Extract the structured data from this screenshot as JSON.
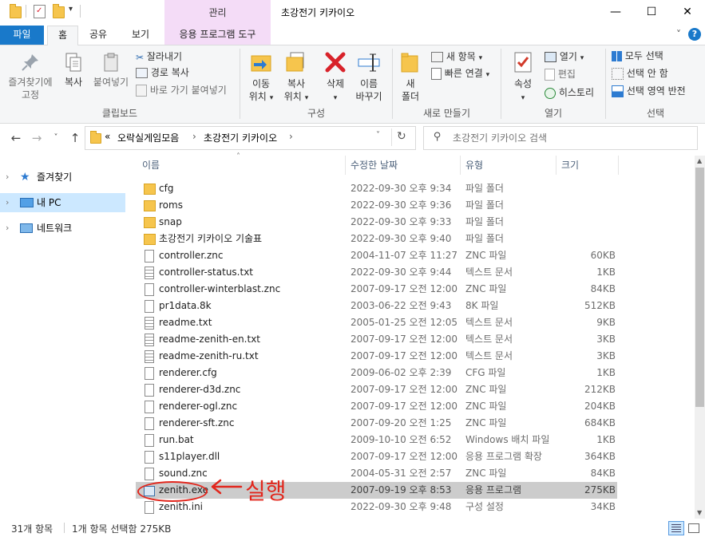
{
  "titlebar": {
    "manage_label": "관리",
    "window_title": "초강전기 키카이오",
    "minimize": "—",
    "maximize": "☐",
    "close": "✕"
  },
  "ribbon_tabs": {
    "file": "파일",
    "home": "홈",
    "share": "공유",
    "view": "보기",
    "app_tools": "응용 프로그램 도구",
    "expand": "˅",
    "help": "?"
  },
  "ribbon": {
    "clipboard": {
      "pin_label1": "즐겨찾기에",
      "pin_label2": "고정",
      "copy": "복사",
      "paste": "붙여넣기",
      "cut": "잘라내기",
      "copy_path": "경로 복사",
      "paste_shortcut": "바로 가기 붙여넣기",
      "group_label": "클립보드"
    },
    "organize": {
      "move_to1": "이동",
      "move_to2": "위치",
      "copy_to1": "복사",
      "copy_to2": "위치",
      "delete": "삭제",
      "rename1": "이름",
      "rename2": "바꾸기",
      "group_label": "구성"
    },
    "new": {
      "new_folder1": "새",
      "new_folder2": "폴더",
      "new_item": "새 항목",
      "easy_access": "빠른 연결",
      "group_label": "새로 만들기"
    },
    "open": {
      "properties": "속성",
      "open": "열기",
      "edit": "편집",
      "history": "히스토리",
      "group_label": "열기"
    },
    "select": {
      "select_all": "모두 선택",
      "select_none": "선택 안 함",
      "invert": "선택 영역 반전",
      "group_label": "선택"
    }
  },
  "navbar": {
    "back": "←",
    "forward": "→",
    "recent": "˅",
    "up": "↑",
    "breadcrumb_overflow": "«",
    "crumb1": "오락실게임모음",
    "crumb2": "초강전기 키카이오",
    "sep": "›",
    "refresh": "↻",
    "search_placeholder": "초강전기 키카이오 검색"
  },
  "navpane": {
    "items": [
      {
        "label": "즐겨찾기"
      },
      {
        "label": "내 PC"
      },
      {
        "label": "네트워크"
      }
    ]
  },
  "columns": {
    "name": "이름",
    "modified": "수정한 날짜",
    "type": "유형",
    "size": "크기"
  },
  "files": [
    {
      "name": "cfg",
      "date": "2022-09-30 오후 9:34",
      "type": "파일 폴더",
      "size": "",
      "icon": "folder"
    },
    {
      "name": "roms",
      "date": "2022-09-30 오후 9:36",
      "type": "파일 폴더",
      "size": "",
      "icon": "folder"
    },
    {
      "name": "snap",
      "date": "2022-09-30 오후 9:33",
      "type": "파일 폴더",
      "size": "",
      "icon": "folder"
    },
    {
      "name": "초강전기 키카이오 기술표",
      "date": "2022-09-30 오후 9:40",
      "type": "파일 폴더",
      "size": "",
      "icon": "folder"
    },
    {
      "name": "controller.znc",
      "date": "2004-11-07 오후 11:27",
      "type": "ZNC 파일",
      "size": "60KB",
      "icon": "file"
    },
    {
      "name": "controller-status.txt",
      "date": "2022-09-30 오후 9:44",
      "type": "텍스트 문서",
      "size": "1KB",
      "icon": "text"
    },
    {
      "name": "controller-winterblast.znc",
      "date": "2007-09-17 오전 12:00",
      "type": "ZNC 파일",
      "size": "84KB",
      "icon": "file"
    },
    {
      "name": "pr1data.8k",
      "date": "2003-06-22 오전 9:43",
      "type": "8K 파일",
      "size": "512KB",
      "icon": "file"
    },
    {
      "name": "readme.txt",
      "date": "2005-01-25 오전 12:05",
      "type": "텍스트 문서",
      "size": "9KB",
      "icon": "text"
    },
    {
      "name": "readme-zenith-en.txt",
      "date": "2007-09-17 오전 12:00",
      "type": "텍스트 문서",
      "size": "3KB",
      "icon": "text"
    },
    {
      "name": "readme-zenith-ru.txt",
      "date": "2007-09-17 오전 12:00",
      "type": "텍스트 문서",
      "size": "3KB",
      "icon": "text"
    },
    {
      "name": "renderer.cfg",
      "date": "2009-06-02 오후 2:39",
      "type": "CFG 파일",
      "size": "1KB",
      "icon": "file"
    },
    {
      "name": "renderer-d3d.znc",
      "date": "2007-09-17 오전 12:00",
      "type": "ZNC 파일",
      "size": "212KB",
      "icon": "file"
    },
    {
      "name": "renderer-ogl.znc",
      "date": "2007-09-17 오전 12:00",
      "type": "ZNC 파일",
      "size": "204KB",
      "icon": "file"
    },
    {
      "name": "renderer-sft.znc",
      "date": "2007-09-20 오전 1:25",
      "type": "ZNC 파일",
      "size": "684KB",
      "icon": "file"
    },
    {
      "name": "run.bat",
      "date": "2009-10-10 오전 6:52",
      "type": "Windows 배치 파일",
      "size": "1KB",
      "icon": "cfg"
    },
    {
      "name": "s11player.dll",
      "date": "2007-09-17 오전 12:00",
      "type": "응용 프로그램 확장",
      "size": "364KB",
      "icon": "cfg"
    },
    {
      "name": "sound.znc",
      "date": "2004-05-31 오전 2:57",
      "type": "ZNC 파일",
      "size": "84KB",
      "icon": "file"
    },
    {
      "name": "zenith.exe",
      "date": "2007-09-19 오후 8:53",
      "type": "응용 프로그램",
      "size": "275KB",
      "icon": "exe",
      "selected": true
    },
    {
      "name": "zenith.ini",
      "date": "2022-09-30 오후 9:48",
      "type": "구성 설정",
      "size": "34KB",
      "icon": "cfg"
    }
  ],
  "status": {
    "count": "31개 항목",
    "selection": "1개 항목 선택함 275KB"
  },
  "annotation": {
    "text": "실행",
    "color": "#e2261c"
  },
  "colors": {
    "file_tab": "#1979ca",
    "manage_tab": "#f4dcf7",
    "selection": "#cccccc",
    "folder": "#f6c54d"
  }
}
